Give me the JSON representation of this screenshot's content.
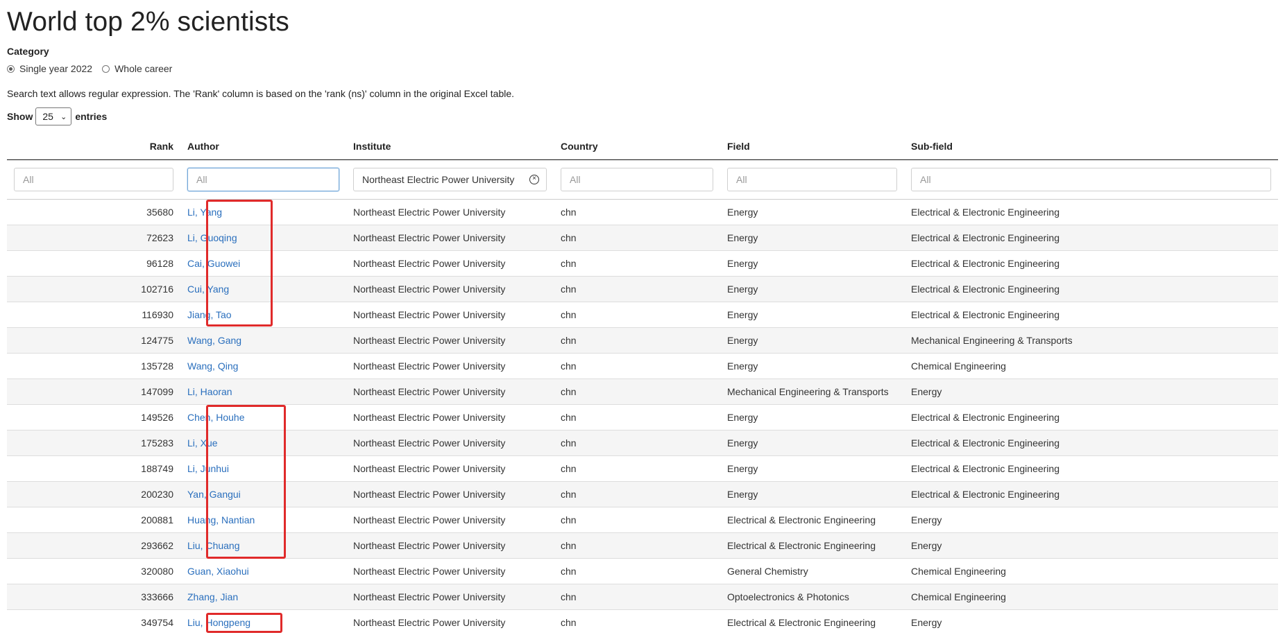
{
  "page_title": "World top 2% scientists",
  "category": {
    "label": "Category",
    "options": [
      {
        "label": "Single year 2022",
        "selected": true
      },
      {
        "label": "Whole career",
        "selected": false
      }
    ]
  },
  "hint": "Search text allows regular expression. The 'Rank' column is based on the 'rank (ns)' column in the original Excel table.",
  "show": {
    "prefix": "Show",
    "value": "25",
    "suffix": "entries"
  },
  "columns": [
    "Rank",
    "Author",
    "Institute",
    "Country",
    "Field",
    "Sub-field"
  ],
  "filters": {
    "rank_placeholder": "All",
    "author_placeholder": "All",
    "institute_value": "Northeast Electric Power University",
    "country_placeholder": "All",
    "field_placeholder": "All",
    "subfield_placeholder": "All"
  },
  "rows": [
    {
      "rank": "35680",
      "author": "Li, Yang",
      "institute": "Northeast Electric Power University",
      "country": "chn",
      "field": "Energy",
      "subfield": "Electrical & Electronic Engineering"
    },
    {
      "rank": "72623",
      "author": "Li, Guoqing",
      "institute": "Northeast Electric Power University",
      "country": "chn",
      "field": "Energy",
      "subfield": "Electrical & Electronic Engineering"
    },
    {
      "rank": "96128",
      "author": "Cai, Guowei",
      "institute": "Northeast Electric Power University",
      "country": "chn",
      "field": "Energy",
      "subfield": "Electrical & Electronic Engineering"
    },
    {
      "rank": "102716",
      "author": "Cui, Yang",
      "institute": "Northeast Electric Power University",
      "country": "chn",
      "field": "Energy",
      "subfield": "Electrical & Electronic Engineering"
    },
    {
      "rank": "116930",
      "author": "Jiang, Tao",
      "institute": "Northeast Electric Power University",
      "country": "chn",
      "field": "Energy",
      "subfield": "Electrical & Electronic Engineering"
    },
    {
      "rank": "124775",
      "author": "Wang, Gang",
      "institute": "Northeast Electric Power University",
      "country": "chn",
      "field": "Energy",
      "subfield": "Mechanical Engineering & Transports"
    },
    {
      "rank": "135728",
      "author": "Wang, Qing",
      "institute": "Northeast Electric Power University",
      "country": "chn",
      "field": "Energy",
      "subfield": "Chemical Engineering"
    },
    {
      "rank": "147099",
      "author": "Li, Haoran",
      "institute": "Northeast Electric Power University",
      "country": "chn",
      "field": "Mechanical Engineering & Transports",
      "subfield": "Energy"
    },
    {
      "rank": "149526",
      "author": "Chen, Houhe",
      "institute": "Northeast Electric Power University",
      "country": "chn",
      "field": "Energy",
      "subfield": "Electrical & Electronic Engineering"
    },
    {
      "rank": "175283",
      "author": "Li, Xue",
      "institute": "Northeast Electric Power University",
      "country": "chn",
      "field": "Energy",
      "subfield": "Electrical & Electronic Engineering"
    },
    {
      "rank": "188749",
      "author": "Li, Junhui",
      "institute": "Northeast Electric Power University",
      "country": "chn",
      "field": "Energy",
      "subfield": "Electrical & Electronic Engineering"
    },
    {
      "rank": "200230",
      "author": "Yan, Gangui",
      "institute": "Northeast Electric Power University",
      "country": "chn",
      "field": "Energy",
      "subfield": "Electrical & Electronic Engineering"
    },
    {
      "rank": "200881",
      "author": "Huang, Nantian",
      "institute": "Northeast Electric Power University",
      "country": "chn",
      "field": "Electrical & Electronic Engineering",
      "subfield": "Energy"
    },
    {
      "rank": "293662",
      "author": "Liu, Chuang",
      "institute": "Northeast Electric Power University",
      "country": "chn",
      "field": "Electrical & Electronic Engineering",
      "subfield": "Energy"
    },
    {
      "rank": "320080",
      "author": "Guan, Xiaohui",
      "institute": "Northeast Electric Power University",
      "country": "chn",
      "field": "General Chemistry",
      "subfield": "Chemical Engineering"
    },
    {
      "rank": "333666",
      "author": "Zhang, Jian",
      "institute": "Northeast Electric Power University",
      "country": "chn",
      "field": "Optoelectronics & Photonics",
      "subfield": "Chemical Engineering"
    },
    {
      "rank": "349754",
      "author": "Liu, Hongpeng",
      "institute": "Northeast Electric Power University",
      "country": "chn",
      "field": "Electrical & Electronic Engineering",
      "subfield": "Energy"
    }
  ],
  "highlight_color": "#e02a2a",
  "link_color": "#2a6fbd"
}
